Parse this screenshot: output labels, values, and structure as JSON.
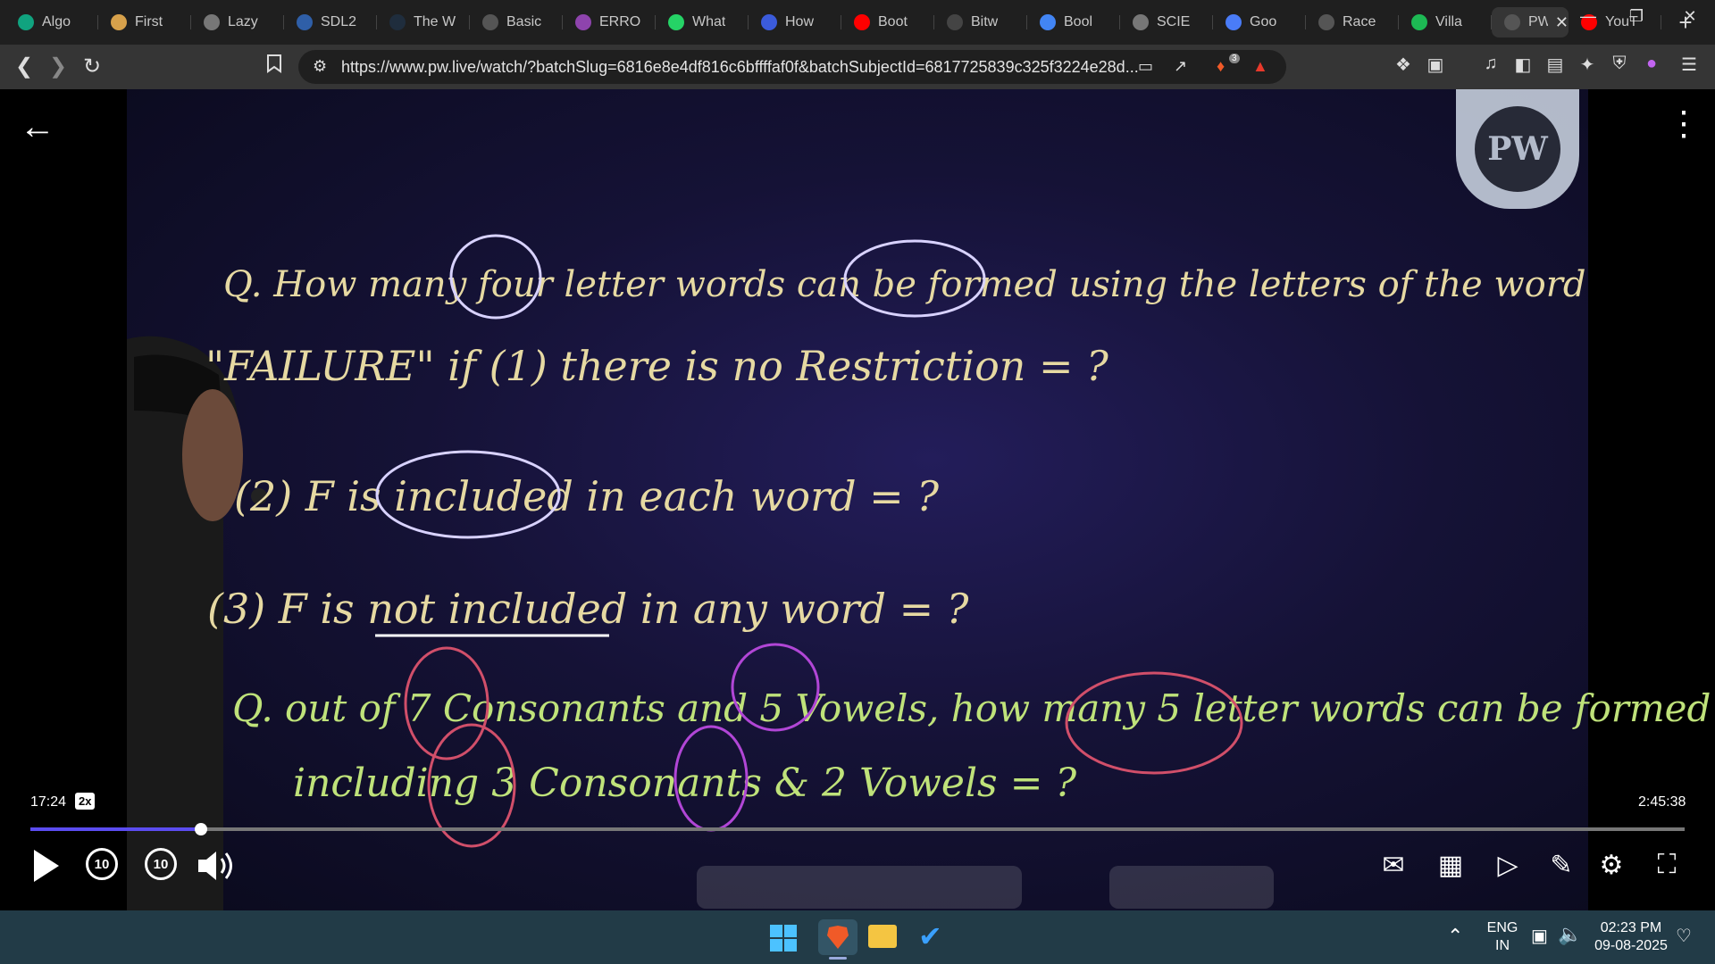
{
  "browser": {
    "tabs": [
      {
        "title": "Algo",
        "icon": "chatgpt-icon",
        "color": "#10a37f"
      },
      {
        "title": "First",
        "icon": "bolt-icon",
        "color": "#d7a14b"
      },
      {
        "title": "Lazy",
        "icon": "globe-icon",
        "color": "#777777"
      },
      {
        "title": "SDL2",
        "icon": "sdl-icon",
        "color": "#2f5fa8"
      },
      {
        "title": "The W",
        "icon": "w3schools-icon",
        "color": "#1f2d3d"
      },
      {
        "title": "Basic",
        "icon": "page-icon",
        "color": "#555555"
      },
      {
        "title": "ERRO",
        "icon": "brain-icon",
        "color": "#8e44ad"
      },
      {
        "title": "What",
        "icon": "whatsapp-icon",
        "color": "#25d366"
      },
      {
        "title": "How",
        "icon": "bookmark-icon",
        "color": "#3b5bdb"
      },
      {
        "title": "Boot",
        "icon": "youtube-icon",
        "color": "#ff0000"
      },
      {
        "title": "Bitw",
        "icon": "bitwise-icon",
        "color": "#444444"
      },
      {
        "title": "Bool",
        "icon": "google-icon",
        "color": "#4285f4"
      },
      {
        "title": "SCIE",
        "icon": "globe-icon",
        "color": "#777777"
      },
      {
        "title": "Goo",
        "icon": "gemini-icon",
        "color": "#4a7cf7"
      },
      {
        "title": "Race",
        "icon": "chatgpt-icon",
        "color": "#555555"
      },
      {
        "title": "Villa",
        "icon": "spotify-icon",
        "color": "#1db954"
      },
      {
        "title": "PW",
        "icon": "audio-icon",
        "color": "#555555",
        "active": true
      },
      {
        "title": "YouT",
        "icon": "youtube-icon",
        "color": "#ff0000"
      }
    ],
    "url": "https://www.pw.live/watch/?batchSlug=6816e8e4df816c6bffffaf0f&batchSubjectId=6817725839c325f3224e28d...",
    "brave_badge": "3"
  },
  "player": {
    "current_time": "17:24",
    "speed": "2x",
    "duration": "2:45:38",
    "progress_fraction": 0.103,
    "skip_back_label": "10",
    "skip_forward_label": "10",
    "watermark_logo": "PW"
  },
  "board": {
    "q1_line1": "Q. How many four letter words can be formed using the letters of the word",
    "q1_line2": "\"FAILURE\" if (1) there is no Restriction = ?",
    "q1_part2": "(2) F is included in each word = ?",
    "q1_part3": "(3) F is not included in any word = ?",
    "q2_line1": "Q. out of 7 Consonants and 5 Vowels, how many 5 letter words can be formed",
    "q2_line2": "including 3 Consonants & 2 Vowels = ?"
  },
  "taskbar": {
    "language_line1": "ENG",
    "language_line2": "IN",
    "time": "02:23 PM",
    "date": "09-08-2025"
  }
}
